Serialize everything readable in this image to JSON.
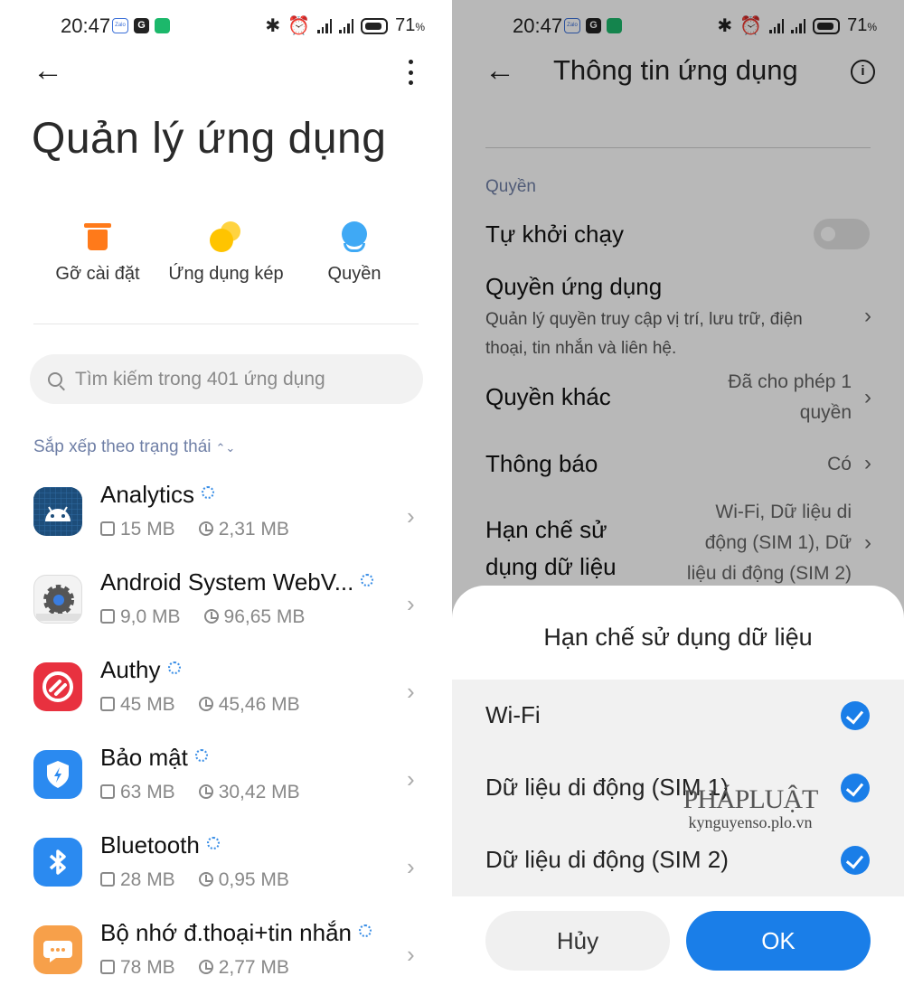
{
  "status_bar": {
    "time": "20:47",
    "battery": "71",
    "battery_unit": "%"
  },
  "left": {
    "title": "Quản lý ứng dụng",
    "shortcuts": [
      {
        "label": "Gỡ cài đặt",
        "icon": "trash-icon"
      },
      {
        "label": "Ứng dụng kép",
        "icon": "dual-apps-icon"
      },
      {
        "label": "Quyền",
        "icon": "permissions-icon"
      }
    ],
    "search": {
      "placeholder": "Tìm kiếm trong 401 ứng dụng"
    },
    "sort_label": "Sắp xếp theo trạng thái",
    "apps": [
      {
        "name": "Analytics",
        "size": "15 MB",
        "cache": "2,31 MB",
        "icon": "android-icon"
      },
      {
        "name": "Android System WebV...",
        "size": "9,0 MB",
        "cache": "96,65 MB",
        "icon": "webview-gear-icon"
      },
      {
        "name": "Authy",
        "size": "45 MB",
        "cache": "45,46 MB",
        "icon": "authy-icon"
      },
      {
        "name": "Bảo mật",
        "size": "63 MB",
        "cache": "30,42 MB",
        "icon": "security-shield-icon"
      },
      {
        "name": "Bluetooth",
        "size": "28 MB",
        "cache": "0,95 MB",
        "icon": "bluetooth-icon"
      },
      {
        "name": "Bộ nhớ đ.thoại+tin nhắn",
        "size": "78 MB",
        "cache": "2,77 MB",
        "icon": "messages-storage-icon"
      }
    ]
  },
  "right": {
    "title": "Thông tin ứng dụng",
    "section": "Quyền",
    "autostart": "Tự khởi chạy",
    "app_permissions": "Quyền ứng dụng",
    "app_permissions_desc": "Quản lý quyền truy cập vị trí, lưu trữ, điện thoại, tin nhắn và liên hệ.",
    "other_permissions": "Quyền khác",
    "other_permissions_value_1": "Đã cho phép 1",
    "other_permissions_value_2": "quyền",
    "notifications": "Thông báo",
    "notifications_value": "Có",
    "data_restrict_1": "Hạn chế sử",
    "data_restrict_2": "dụng dữ liệu",
    "data_restrict_value_1": "Wi-Fi, Dữ liệu di",
    "data_restrict_value_2": "động (SIM 1), Dữ",
    "data_restrict_value_3": "liệu di động (SIM 2)",
    "sheet": {
      "title": "Hạn chế sử dụng dữ liệu",
      "options": [
        "Wi-Fi",
        "Dữ liệu di động (SIM 1)",
        "Dữ liệu di động (SIM 2)"
      ],
      "cancel": "Hủy",
      "ok": "OK"
    },
    "watermark": {
      "brand": "PHÁPLUẬT",
      "site": "kynguyenso.plo.vn"
    }
  },
  "colors": {
    "accent": "#1a7ee8",
    "section": "#6f7fa6",
    "orange": "#ff7a1a",
    "yellow": "#ffc400"
  }
}
